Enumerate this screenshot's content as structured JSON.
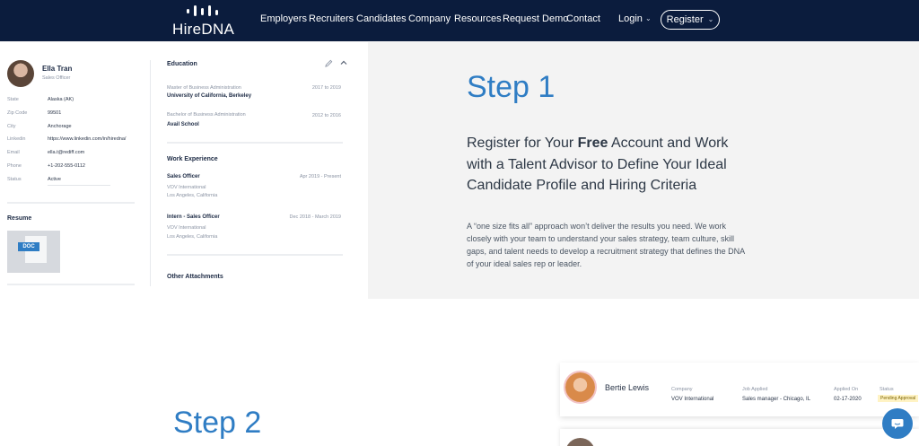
{
  "nav": {
    "logo_text": "HireDNA",
    "links": [
      "Employers",
      "Recruiters",
      "Candidates",
      "Company",
      "Resources",
      "Request Demo",
      "Contact"
    ],
    "login": "Login",
    "register": "Register",
    "colors": {
      "background": "#0b1c3d",
      "accent": "#2f7dc4"
    }
  },
  "profile": {
    "name": "Ella Tran",
    "title": "Sales Officer",
    "fields": [
      {
        "label": "State",
        "value": "Alaska (AK)"
      },
      {
        "label": "Zip Code",
        "value": "99501"
      },
      {
        "label": "City",
        "value": "Anchorage"
      },
      {
        "label": "Linkedin",
        "value": "https://www.linkedin.com/in/hiredna/"
      },
      {
        "label": "Email",
        "value": "ella.t@rediff.com"
      },
      {
        "label": "Phone",
        "value": "+1-202-555-0112"
      },
      {
        "label": "Status",
        "value": "Active"
      }
    ],
    "resume_label": "Resume",
    "resume_badge": "DOC",
    "education_title": "Education",
    "education": [
      {
        "degree": "Master of Business Administration",
        "school": "University of California, Berkeley",
        "dates": "2017 to 2019"
      },
      {
        "degree": "Bachelor of Business Administration",
        "school": "Avail School",
        "dates": "2012 to 2016"
      }
    ],
    "work_title": "Work Experience",
    "work": [
      {
        "role": "Sales Officer",
        "company": "VOV International",
        "location": "Los Angeles, California",
        "dates": "Apr 2019 - Present"
      },
      {
        "role": "Intern - Sales Officer",
        "company": "VOV International",
        "location": "Los Angeles, California",
        "dates": "Dec 2018 - March 2019"
      }
    ],
    "attachments_title": "Other Attachments"
  },
  "step1": {
    "heading": "Step 1",
    "headline_pre": "Register for Your ",
    "headline_bold": "Free",
    "headline_post": " Account and Work with a Talent Advisor to Define Your Ideal Candidate Profile and Hiring Criteria",
    "body": "A “one size fits all” approach won’t deliver the results you need. We work closely with your team to understand your sales strategy, team culture, skill gaps, and talent needs to develop a recruitment strategy that defines the DNA of your ideal sales rep or leader."
  },
  "step2": {
    "heading": "Step 2"
  },
  "candidate": {
    "name": "Bertie Lewis",
    "company_label": "Company",
    "company": "VOV International",
    "job_label": "Job Applied",
    "job": "Sales manager - Chicago, IL",
    "applied_label": "Applied On",
    "applied": "02-17-2020",
    "status_label": "Status",
    "status": "Pending Approval"
  },
  "icons": {
    "edit": "pencil-icon",
    "collapse": "chevron-up-icon",
    "chat": "chat-bubble-icon"
  }
}
